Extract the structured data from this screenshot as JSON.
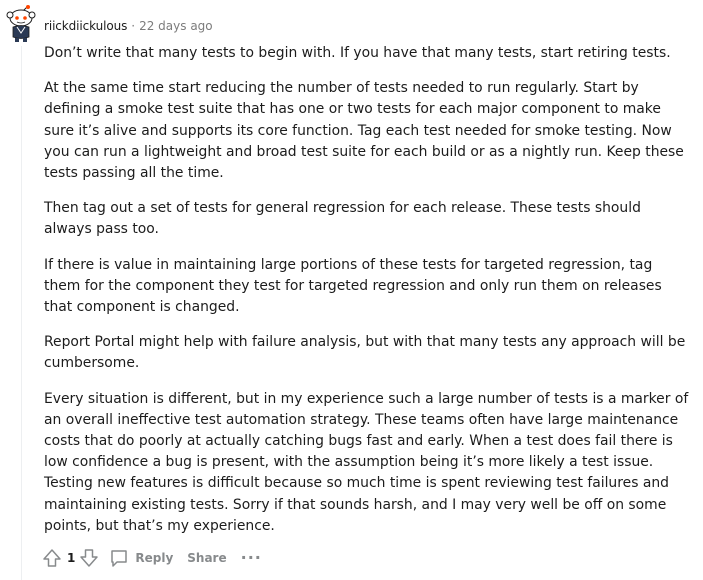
{
  "comment": {
    "author": "riickdiickulous",
    "separator": "·",
    "timestamp": "22 days ago",
    "paragraphs": [
      "Don’t write that many tests to begin with. If you have that many tests, start retiring tests.",
      "At the same time start reducing the number of tests needed to run regularly. Start by defining a smoke test suite that has one or two tests for each major component to make sure it’s alive and supports its core function. Tag each test needed for smoke testing. Now you can run a lightweight and broad test suite for each build or as a nightly run. Keep these tests passing all the time.",
      "Then tag out a set of tests for general regression for each release. These tests should always pass too.",
      "If there is value in maintaining large portions of these tests for targeted regression, tag them for the component they test for targeted regression and only run them on releases that component is changed.",
      "Report Portal might help with failure analysis, but with that many tests any approach will be cumbersome.",
      "Every situation is different, but in my experience such a large number of tests is a marker of an overall ineffective test automation strategy. These teams often have large maintenance costs that do poorly at actually catching bugs fast and early. When a test does fail there is low confidence a bug is present, with the assumption being it’s more likely a test issue. Testing new features is difficult because so much time is spent reviewing test failures and maintaining existing tests. Sorry if that sounds harsh, and I may very well be off on some points, but that’s my experience."
    ],
    "actions": {
      "vote_count": "1",
      "reply_label": "Reply",
      "share_label": "Share",
      "more_label": "···"
    },
    "icons": {
      "avatar": "snoo-avatar-icon",
      "upvote": "upvote-arrow-icon",
      "downvote": "downvote-arrow-icon",
      "reply": "comment-bubble-icon"
    },
    "colors": {
      "text": "#1c1c1c",
      "meta": "#7c7c7c",
      "action": "#878a8c",
      "avatar_orange": "#ff4500"
    }
  }
}
